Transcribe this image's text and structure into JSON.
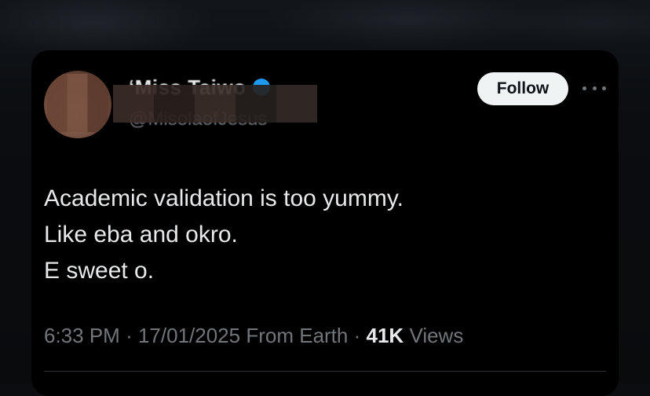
{
  "author": {
    "display_name": "‘Miss Taiwo",
    "handle": "@MisolaofJesus",
    "verified": true,
    "verified_color": "#1d9bf0"
  },
  "actions": {
    "follow_label": "Follow",
    "more_icon": "more-horizontal-icon"
  },
  "tweet": {
    "lines": [
      "Academic validation is too yummy.",
      "Like eba and okro.",
      "E sweet o."
    ]
  },
  "meta": {
    "time": "6:33 PM",
    "separator": "·",
    "date": "17/01/2025",
    "source": "From Earth",
    "views_count": "41K",
    "views_label": "Views"
  },
  "colors": {
    "card_background": "#000000",
    "primary_text": "#e7e9ea",
    "secondary_text": "#71767b",
    "follow_button_bg": "#eff3f4"
  }
}
